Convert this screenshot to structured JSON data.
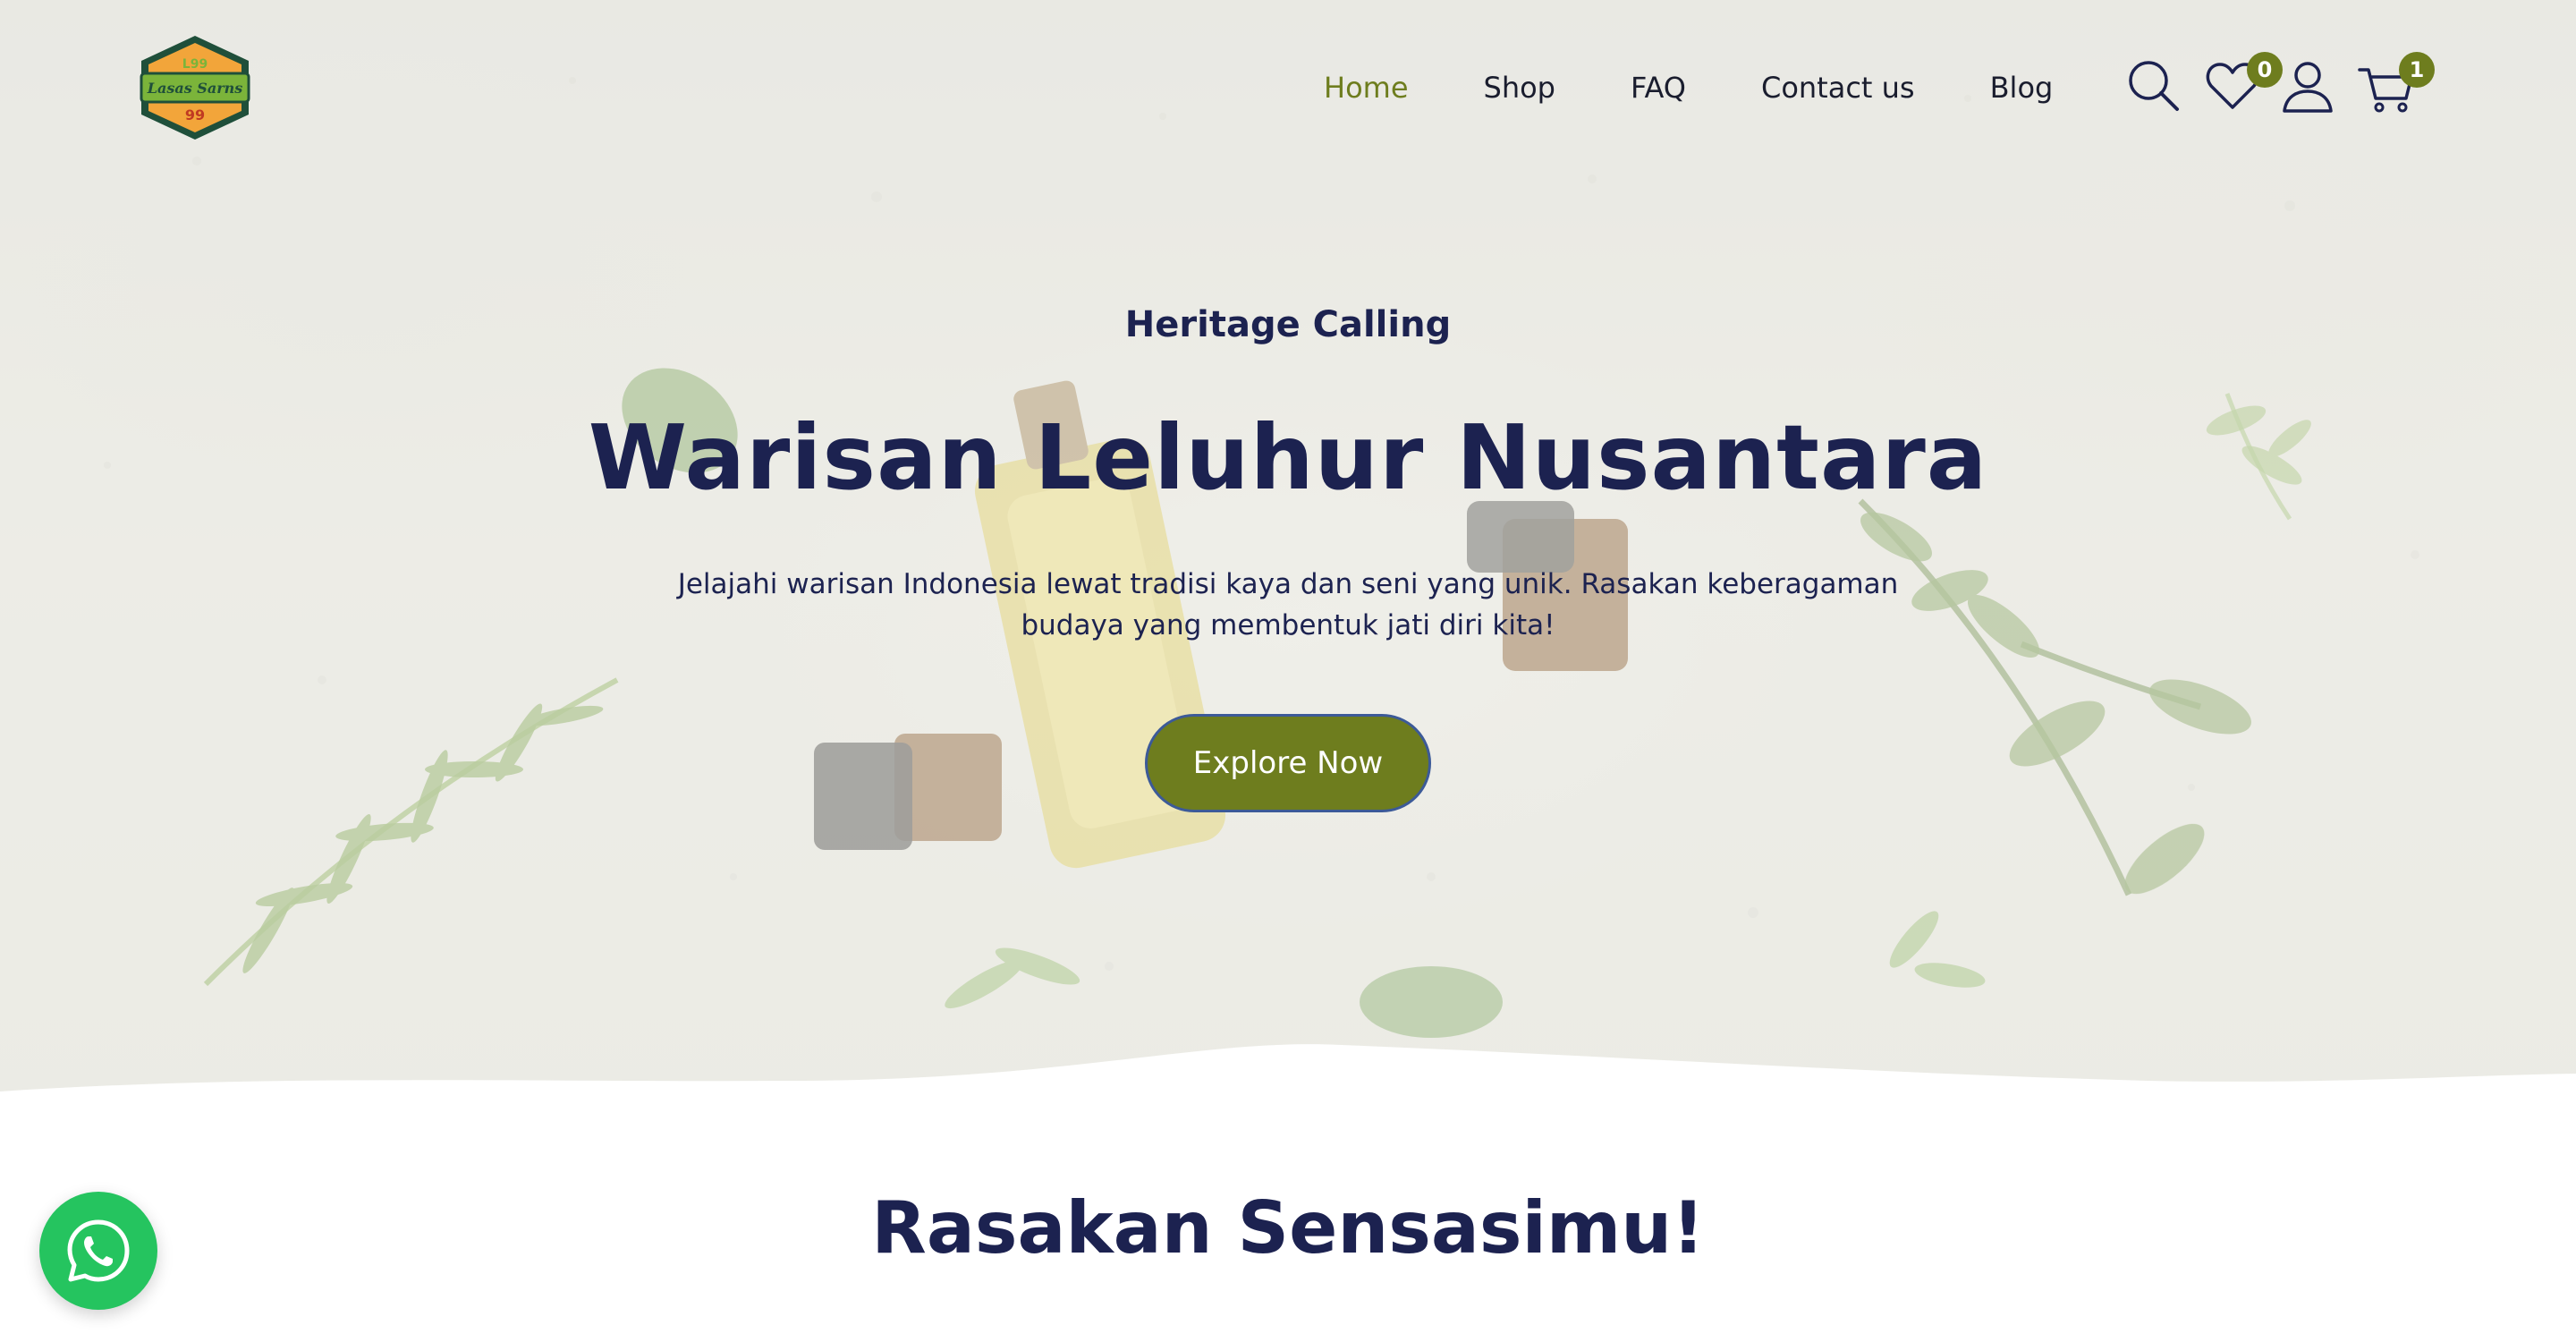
{
  "brand": {
    "logo_text": "Lasas Sarns",
    "logo_number": "99",
    "logo_monogram": "L99"
  },
  "nav": {
    "items": [
      {
        "label": "Home",
        "active": true
      },
      {
        "label": "Shop",
        "active": false
      },
      {
        "label": "FAQ",
        "active": false
      },
      {
        "label": "Contact us",
        "active": false
      },
      {
        "label": "Blog",
        "active": false
      }
    ]
  },
  "header_icons": {
    "search": "search-icon",
    "wishlist": "heart-icon",
    "wishlist_count": "0",
    "account": "user-icon",
    "cart": "cart-icon",
    "cart_count": "1"
  },
  "hero": {
    "eyebrow": "Heritage Calling",
    "headline": "Warisan Leluhur Nusantara",
    "subtext": "Jelajahi warisan Indonesia lewat tradisi kaya dan seni yang unik. Rasakan keberagaman budaya yang membentuk jati diri kita!",
    "cta_label": "Explore Now"
  },
  "section": {
    "title": "Rasakan Sensasimu!"
  },
  "floating": {
    "whatsapp": "whatsapp-icon"
  },
  "colors": {
    "accent": "#6e7d1e",
    "navy": "#1c2250",
    "whatsapp": "#25c45f"
  }
}
